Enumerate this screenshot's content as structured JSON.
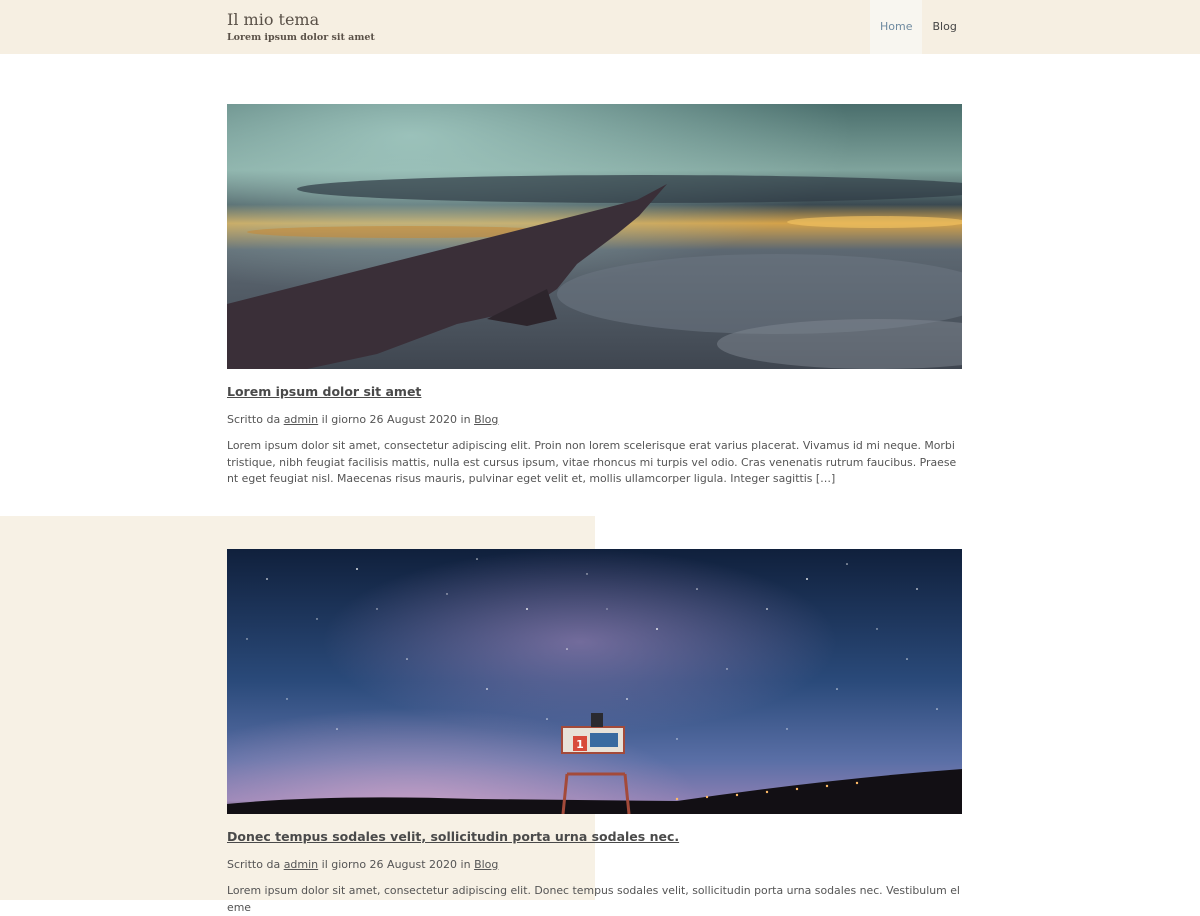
{
  "header": {
    "site_title": "Il mio tema",
    "tagline": "Lorem ipsum dolor sit amet",
    "nav": [
      {
        "label": "Home",
        "active": true
      },
      {
        "label": "Blog",
        "active": false
      }
    ]
  },
  "posts": [
    {
      "image_icon": "airplane-wing-photo",
      "title": "Lorem ipsum dolor sit amet",
      "meta": {
        "prefix": "Scritto da",
        "author": "admin",
        "date_text": "il giorno 26 August 2020 in",
        "category": "Blog"
      },
      "excerpt": "Lorem ipsum dolor sit amet, consectetur adipiscing elit. Proin non lorem scelerisque erat varius placerat. Vivamus id mi neque. Morbi tristique, nibh feugiat facilisis mattis, nulla est cursus ipsum, vitae rhoncus mi turpis vel odio. Cras venenatis rutrum faucibus. Praesent eget feugiat nisl. Maecenas risus mauris, pulvinar eget velit et, mollis ullamcorper ligula. Integer sagittis […]"
    },
    {
      "image_icon": "night-sky-lifeguard-tower-photo",
      "title": "Donec tempus sodales velit, sollicitudin porta urna sodales nec.",
      "meta": {
        "prefix": "Scritto da",
        "author": "admin",
        "date_text": "il giorno 26 August 2020 in",
        "category": "Blog"
      },
      "excerpt": "Lorem ipsum dolor sit amet, consectetur adipiscing elit. Donec tempus sodales velit, sollicitudin porta urna sodales nec. Vestibulum eleme",
      "tower_sign": "1"
    }
  ],
  "colors": {
    "header_bg": "#f6efe2",
    "nav_active_text": "#6e8aa0",
    "accent_block": "#f7f1e5"
  }
}
